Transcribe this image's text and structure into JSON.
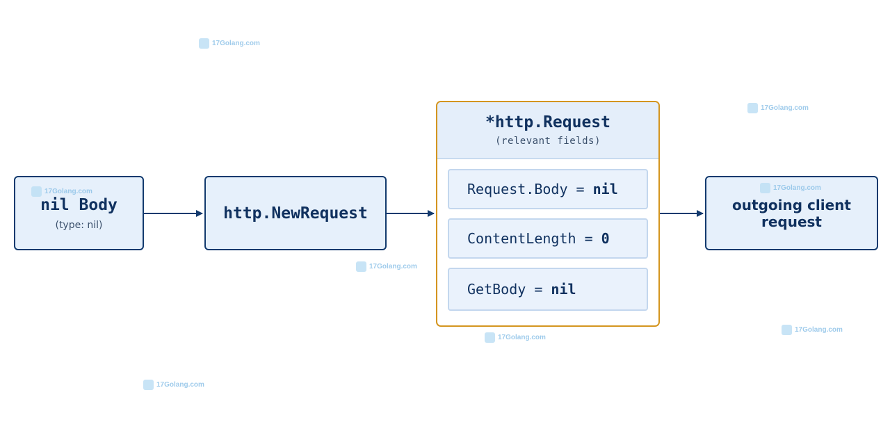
{
  "nodes": {
    "nil_body": {
      "title": "nil Body",
      "subtitle": "(type: nil)"
    },
    "new_request": {
      "title": "http.NewRequest"
    },
    "http_request": {
      "title": "*http.Request",
      "subtitle": "(relevant fields)",
      "fields": [
        {
          "name": "Request.Body",
          "op": " = ",
          "value": "nil"
        },
        {
          "name": "ContentLength",
          "op": " = ",
          "value": "0"
        },
        {
          "name": "GetBody",
          "op": " = ",
          "value": "nil"
        }
      ]
    },
    "outgoing": {
      "title": "outgoing client request"
    }
  },
  "watermark": {
    "text": "17Golang.com"
  },
  "colors": {
    "box_fill": "#e6f0fb",
    "box_border": "#123a6e",
    "struct_border": "#d4951f",
    "text": "#10315f",
    "arrow": "#123a6e",
    "watermark": "#8fc3e8"
  }
}
